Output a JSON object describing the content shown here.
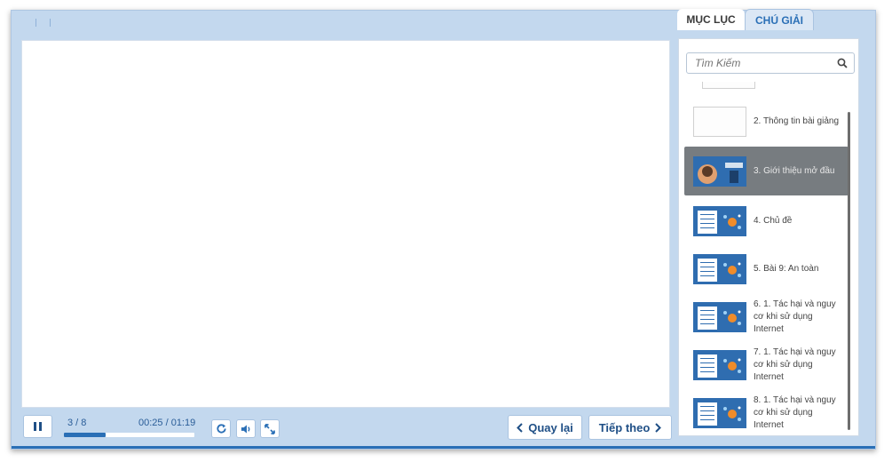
{
  "player": {
    "slide_counter": "3 / 8",
    "time_display": "00:25 / 01:19",
    "progress_fraction": 0.32,
    "pause_icon": "pause-icon",
    "replay_icon": "replay-icon",
    "volume_icon": "volume-icon",
    "fullscreen_icon": "fullscreen-icon"
  },
  "navigation": {
    "prev_label": "Quay lại",
    "next_label": "Tiếp theo"
  },
  "sidebar": {
    "tabs": [
      {
        "label": "MỤC LỤC",
        "active": true
      },
      {
        "label": "CHÚ GIẢI",
        "active": false
      }
    ],
    "search": {
      "placeholder": "Tìm Kiếm",
      "value": ""
    },
    "items": [
      {
        "label": "2. Thông tin bài giảng",
        "active": false
      },
      {
        "label": "3. Giới thiệu mở đầu",
        "active": true
      },
      {
        "label": "4. Chủ đề",
        "active": false
      },
      {
        "label": "5. Bài 9: An toàn",
        "active": false
      },
      {
        "label": "6. 1. Tác hại và nguy cơ khi sử dụng Internet",
        "active": false
      },
      {
        "label": "7. 1. Tác hại và nguy cơ khi sử dụng Internet",
        "active": false
      },
      {
        "label": "8. 1. Tác hại và nguy cơ khi sử dụng Internet",
        "active": false
      }
    ]
  },
  "colors": {
    "frame": "#c3d8ee",
    "accent": "#2a6fb6",
    "active_item": "#777c80"
  }
}
